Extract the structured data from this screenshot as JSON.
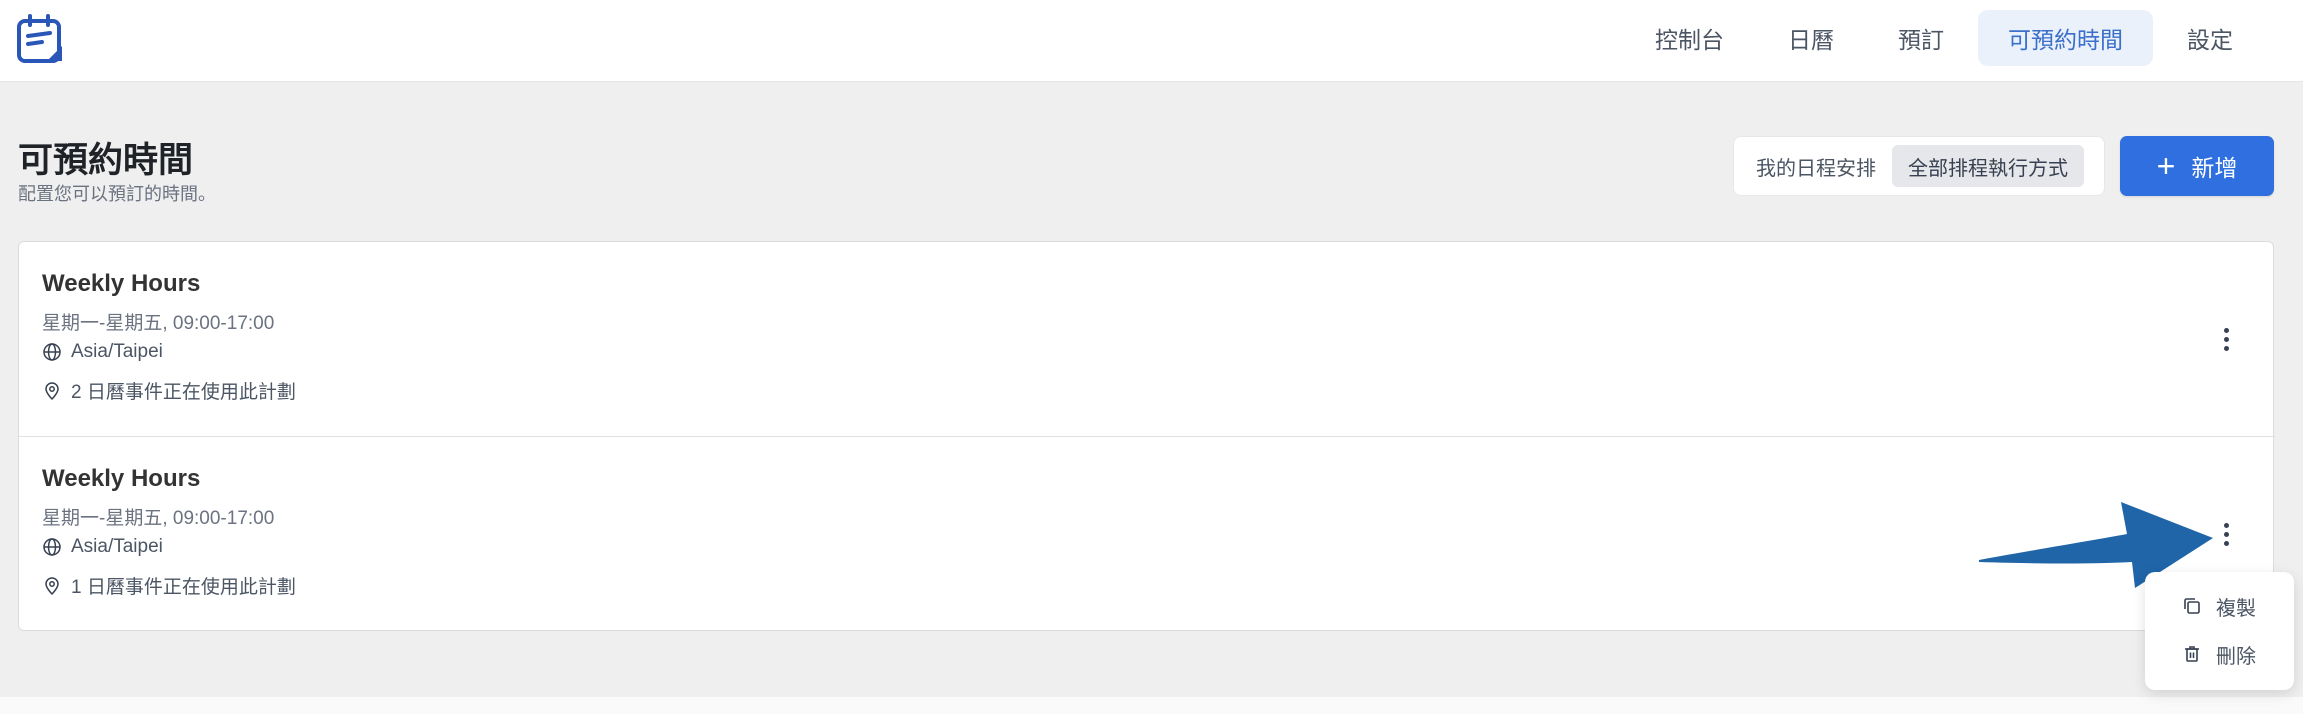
{
  "nav": {
    "items": [
      {
        "label": "控制台"
      },
      {
        "label": "日曆"
      },
      {
        "label": "預訂"
      },
      {
        "label": "可預約時間",
        "active": true
      },
      {
        "label": "設定"
      }
    ]
  },
  "page": {
    "title": "可預約時間",
    "subtitle": "配置您可以預訂的時間。"
  },
  "view_toggle": {
    "my_schedule": "我的日程安排",
    "all_schedules": "全部排程執行方式"
  },
  "add_button": {
    "label": "新增"
  },
  "schedules": [
    {
      "title": "Weekly Hours",
      "days": "星期一-星期五, 09:00-17:00",
      "timezone": "Asia/Taipei",
      "usage": "2 日曆事件正在使用此計劃"
    },
    {
      "title": "Weekly Hours",
      "days": "星期一-星期五, 09:00-17:00",
      "timezone": "Asia/Taipei",
      "usage": "1 日曆事件正在使用此計劃"
    }
  ],
  "menu": {
    "duplicate": "複製",
    "delete": "刪除"
  },
  "colors": {
    "accent": "#2f6fe0",
    "nav_active_bg": "#eaf1fb",
    "nav_active_text": "#3b6fc9",
    "annotation_arrow": "#1f65a8"
  },
  "icons": [
    "app-logo-icon",
    "globe-icon",
    "map-pin-icon",
    "kebab-menu-icon",
    "plus-icon",
    "copy-icon",
    "trash-icon"
  ]
}
